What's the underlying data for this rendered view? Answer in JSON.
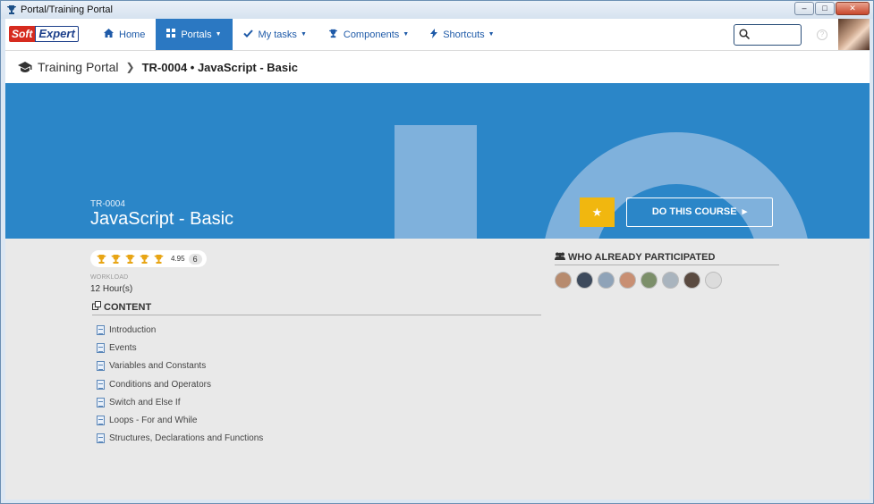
{
  "window": {
    "title": "Portal/Training Portal"
  },
  "nav": {
    "logo_left": "Soft",
    "logo_right": "Expert",
    "items": [
      {
        "label": "Home",
        "icon": "home-icon"
      },
      {
        "label": "Portals",
        "icon": "grid-icon",
        "active": true
      },
      {
        "label": "My tasks",
        "icon": "check-icon"
      },
      {
        "label": "Components",
        "icon": "trophy-icon"
      },
      {
        "label": "Shortcuts",
        "icon": "bolt-icon"
      }
    ],
    "search_placeholder": "",
    "help_label": "?"
  },
  "breadcrumb": {
    "root": "Training Portal",
    "current": "TR-0004 • JavaScript - Basic"
  },
  "course": {
    "code": "TR-0004",
    "title": "JavaScript - Basic",
    "cta_label": "DO THIS COURSE",
    "rating_score": "4.95",
    "rating_count": "6",
    "trophies": 5,
    "workload_label": "WORKLOAD",
    "workload_value": "12 Hour(s)"
  },
  "content": {
    "heading": "CONTENT",
    "items": [
      "Introduction",
      "Events",
      "Variables and Constants",
      "Conditions and Operators",
      "Switch and Else If",
      "Loops - For and While",
      "Structures, Declarations and Functions"
    ]
  },
  "participants": {
    "heading": "WHO ALREADY PARTICIPATED",
    "avatars": [
      {
        "color": "#b78b6e"
      },
      {
        "color": "#3d4a5c"
      },
      {
        "color": "#8fa3b8"
      },
      {
        "color": "#c88f73"
      },
      {
        "color": "#7c8f6a"
      },
      {
        "color": "#a9b4be"
      },
      {
        "color": "#5a4a40"
      },
      {
        "color": "#dcdcdc"
      }
    ]
  },
  "colors": {
    "hero": "#2b86c8",
    "accent": "#2b78c2",
    "star": "#f1b70f",
    "trophy": "#e8a514"
  }
}
